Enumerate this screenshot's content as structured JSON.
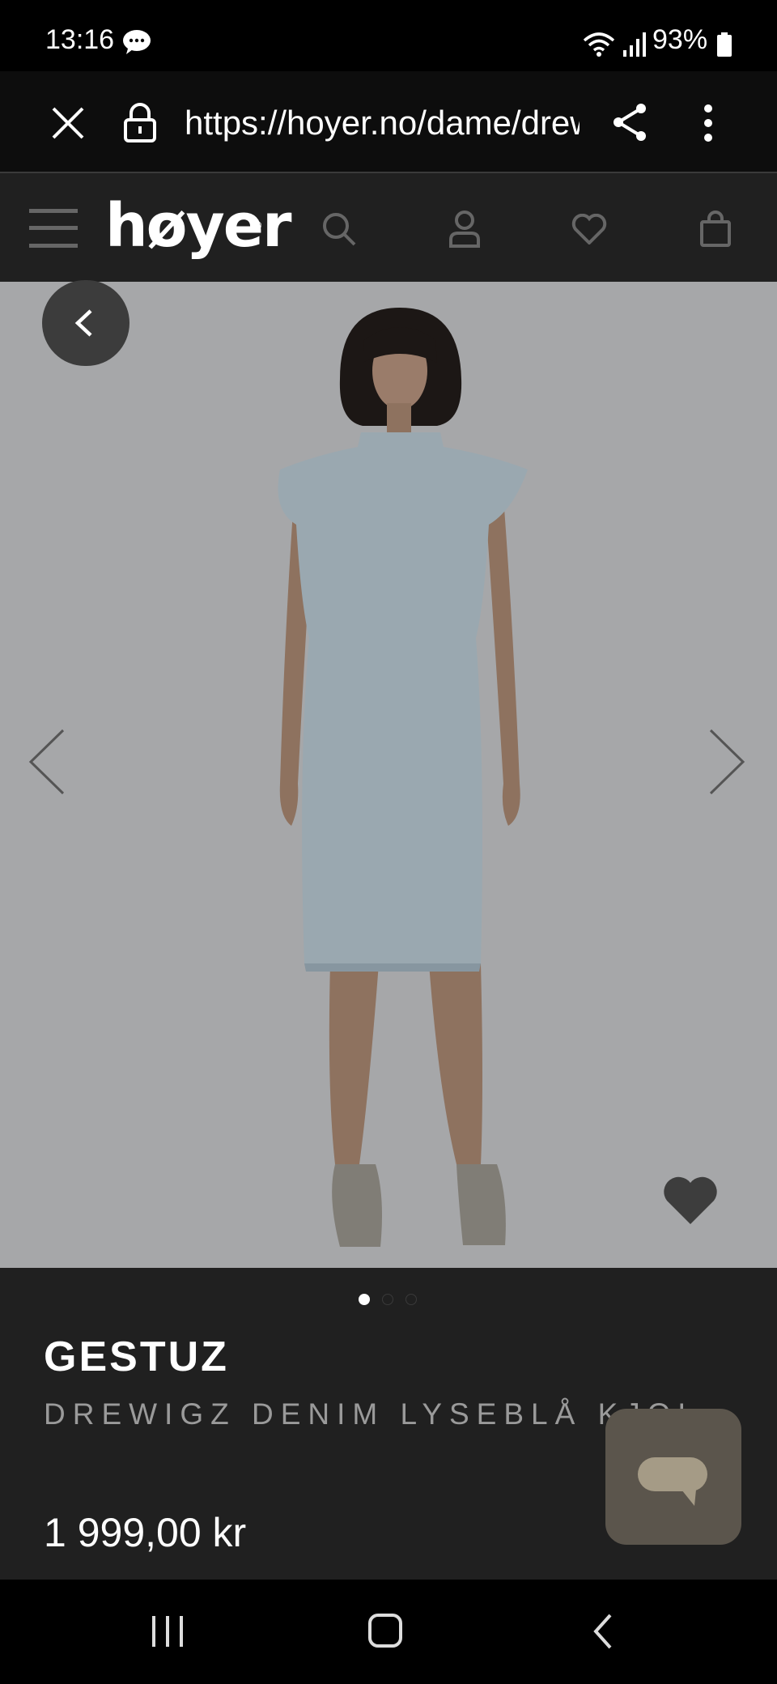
{
  "status_bar": {
    "time": "13:16",
    "battery": "93%"
  },
  "browser": {
    "url": "https://hoyer.no/dame/drewigz"
  },
  "site": {
    "logo": "høyer",
    "logo_mark": "®"
  },
  "product": {
    "brand": "GESTUZ",
    "name": "DREWIGZ DENIM LYSEBLÅ KJOLE",
    "price": "1 999,00 kr",
    "image_count": 3,
    "active_image": 1
  },
  "colors": {
    "background": "#202020",
    "image_bg": "#a6a7a9",
    "chat": "#5b554c",
    "dress": "#9aa8b0"
  },
  "icons": [
    "chat-bubble-icon",
    "close-icon",
    "lock-icon",
    "share-icon",
    "more-vert-icon",
    "menu-icon",
    "search-icon",
    "user-icon",
    "heart-icon",
    "bag-icon",
    "chevron-left-icon",
    "chevron-right-icon",
    "home-icon",
    "recents-icon",
    "back-icon"
  ]
}
